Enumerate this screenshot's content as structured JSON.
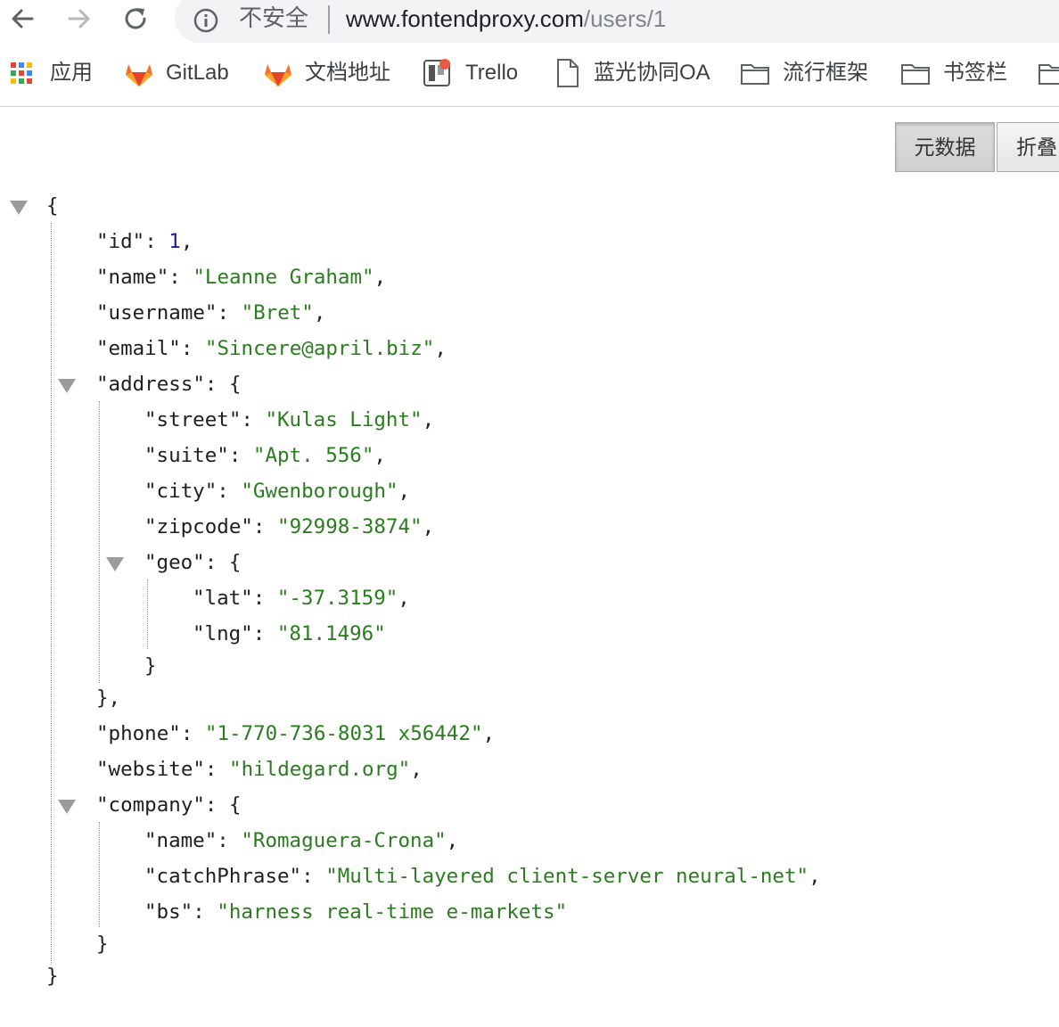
{
  "browser": {
    "insecure_label": "不安全",
    "url_host": "www.fontendproxy.com",
    "url_path": "/users/1"
  },
  "bookmarks": [
    {
      "label": "应用",
      "icon": "apps-grid-icon"
    },
    {
      "label": "GitLab",
      "icon": "gitlab-icon"
    },
    {
      "label": "文档地址",
      "icon": "gitlab-icon"
    },
    {
      "label": "Trello",
      "icon": "trello-icon"
    },
    {
      "label": "蓝光协同OA",
      "icon": "document-icon"
    },
    {
      "label": "流行框架",
      "icon": "folder-icon"
    },
    {
      "label": "书签栏",
      "icon": "folder-icon"
    }
  ],
  "viewer": {
    "raw_label": "元数据",
    "fold_label": "折叠"
  },
  "json": {
    "id": "1",
    "name": "Leanne Graham",
    "username": "Bret",
    "email": "Sincere@april.biz",
    "address": {
      "street": "Kulas Light",
      "suite": "Apt. 556",
      "city": "Gwenborough",
      "zipcode": "92998-3874",
      "geo": {
        "lat": "-37.3159",
        "lng": "81.1496"
      }
    },
    "phone": "1-770-736-8031 x56442",
    "website": "hildegard.org",
    "company": {
      "name": "Romaguera-Crona",
      "catchPhrase": "Multi-layered client-server neural-net",
      "bs": "harness real-time e-markets"
    }
  },
  "keys": {
    "id": "\"id\"",
    "name": "\"name\"",
    "username": "\"username\"",
    "email": "\"email\"",
    "address": "\"address\"",
    "street": "\"street\"",
    "suite": "\"suite\"",
    "city": "\"city\"",
    "zipcode": "\"zipcode\"",
    "geo": "\"geo\"",
    "lat": "\"lat\"",
    "lng": "\"lng\"",
    "phone": "\"phone\"",
    "website": "\"website\"",
    "company": "\"company\"",
    "catchPhrase": "\"catchPhrase\"",
    "bs": "\"bs\""
  },
  "colors": {
    "string": "#2a7d1e",
    "number": "#1a1aa6",
    "key": "#1f1f1f"
  }
}
